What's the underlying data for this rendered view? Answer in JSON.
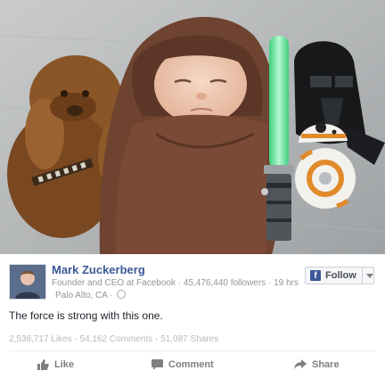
{
  "post": {
    "author_name": "Mark Zuckerberg",
    "author_title": "Founder and CEO at Facebook",
    "followers": "45,476,440 followers",
    "time": "19 hrs",
    "location": "Palo Alto, CA",
    "message": "The force is strong with this one.",
    "likes": "2,538,717 Likes",
    "comments": "54,162 Comments",
    "shares": "51,087 Shares"
  },
  "follow_button": {
    "label": "Follow",
    "icon": "facebook-f-icon"
  },
  "actions": {
    "like": "Like",
    "comment": "Comment",
    "share": "Share"
  },
  "colors": {
    "brand": "#3b5998",
    "meta_text": "#90949c",
    "lightsaber": "#4cd98a"
  }
}
